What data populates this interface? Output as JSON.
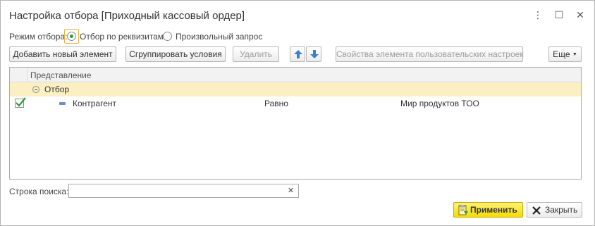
{
  "window": {
    "title": "Настройка отбора [Приходный кассовый ордер]",
    "more_glyph": "⋮",
    "maximize_glyph": "☐",
    "close_glyph": "✕"
  },
  "mode": {
    "label": "Режим отбора:",
    "options": [
      {
        "label": "Отбор по реквизитам",
        "selected": true
      },
      {
        "label": "Произвольный запрос",
        "selected": false
      }
    ]
  },
  "toolbar": {
    "add_element": "Добавить новый элемент",
    "group_conditions": "Сгруппировать условия",
    "delete": "Удалить",
    "custom_settings_props": "Свойства элемента пользовательских настроек",
    "more": "Еще"
  },
  "grid": {
    "header": "Представление",
    "group_row": {
      "label": "Отбор"
    },
    "rows": [
      {
        "checked": true,
        "field": "Контрагент",
        "condition": "Равно",
        "value": "Мир продуктов ТОО"
      }
    ]
  },
  "search": {
    "label": "Строка поиска:",
    "value": "",
    "placeholder": ""
  },
  "footer": {
    "apply": "Применить",
    "close": "Закрыть"
  },
  "colors": {
    "group_row_bg": "#fbf0c3",
    "apply_bg": "#f5dc00",
    "radio_selected": "#2f9a3a",
    "arrow_blue": "#3b7fd6"
  }
}
